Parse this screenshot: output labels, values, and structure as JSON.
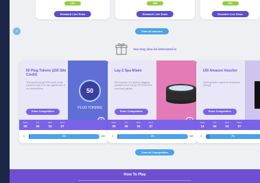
{
  "top_cards": [
    {
      "pill": "121",
      "button": "Rewatch Live Draw"
    },
    {
      "pill": "288",
      "button": "Rewatch Live Draw"
    },
    {
      "pill": "166",
      "button": "Rewatch Live Draw"
    }
  ],
  "nav": {
    "view_all_top": "View all winners",
    "prev_icon": "chevron-left-icon"
  },
  "interest": {
    "text": "You may also be interested in",
    "icon": "gift-icon"
  },
  "competitions": [
    {
      "title": "50 Plug Tokens (£50 Site Credit)",
      "description": "This smart and get £50 worth of site credit for only £1 to use against any of our competitions.",
      "enter": "Enter Competition",
      "badge": "1",
      "image_main": "50",
      "image_sub": "PLUG TOKENS",
      "timer": [
        {
          "unit": "Days",
          "value": "08"
        },
        {
          "unit": "Hrs",
          "value": "06"
        },
        {
          "unit": "Mins",
          "value": "04"
        },
        {
          "unit": "Secs",
          "value": "07"
        }
      ],
      "progress_lo": "0",
      "progress_hi": "360",
      "progress_pct": "0%",
      "progress_fraction": 0.02
    },
    {
      "title": "Lay-Z Spa Miami",
      "description": "Hot summer? It's style by bagging yourself a Hot Tub for £1! Perfect for your back garden.",
      "enter": "Enter Competition",
      "badge": "3",
      "timer": [
        {
          "unit": "Days",
          "value": "08"
        },
        {
          "unit": "Hrs",
          "value": "06"
        },
        {
          "unit": "Mins",
          "value": "04"
        },
        {
          "unit": "Secs",
          "value": "07"
        }
      ],
      "progress_lo": "0",
      "progress_hi": "360",
      "progress_pct": "0%",
      "progress_fraction": 0.02
    },
    {
      "title": "£50 Amazon Voucher",
      "description": "Nothing beats a good bit of Amazon therapy!",
      "enter": "Enter Competition",
      "badge": "",
      "timer": [
        {
          "unit": "Days",
          "value": "13"
        },
        {
          "unit": "Hrs",
          "value": "06"
        },
        {
          "unit": "Mins",
          "value": "04"
        },
        {
          "unit": "Secs",
          "value": "07"
        }
      ],
      "progress_lo": "0",
      "progress_hi": "",
      "progress_pct": "7%",
      "progress_fraction": 0.07
    }
  ],
  "view_all_bottom": "View all Competition",
  "how_to_play": "How To Play",
  "colors": {
    "purple": "#6e4fd0",
    "blue": "#4aa3e8",
    "green": "#8fcf3a",
    "navy": "#1c2747"
  }
}
